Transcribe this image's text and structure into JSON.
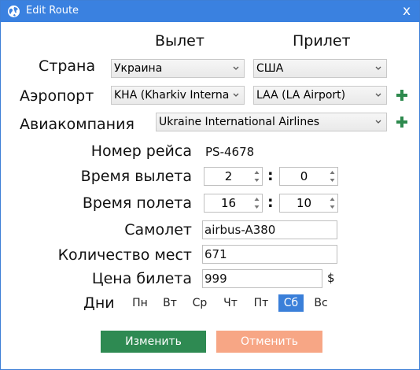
{
  "window": {
    "title": "Edit Route",
    "close_glyph": "x"
  },
  "columns": {
    "departure": "Вылет",
    "arrival": "Прилет"
  },
  "labels": {
    "country": "Страна",
    "airport": "Аэропорт",
    "airline": "Авиакомпания",
    "flight_number": "Номер рейса",
    "departure_time": "Время вылета",
    "flight_time": "Время полета",
    "aircraft": "Самолет",
    "seats": "Количество мест",
    "price": "Цена билета",
    "days": "Дни"
  },
  "fields": {
    "country_from": "Украина",
    "country_to": "США",
    "airport_from": "KHA (Kharkiv Interna",
    "airport_to": "LAA (LA Airport)",
    "airline": "Ukraine International Airlines",
    "flight_number": "PS-4678",
    "departure_hours": "2",
    "departure_minutes": "0",
    "flight_hours": "16",
    "flight_minutes": "10",
    "time_separator": ":",
    "aircraft": "airbus-A380",
    "seats": "671",
    "price": "999",
    "currency": "$"
  },
  "days": [
    {
      "label": "Пн",
      "selected": false
    },
    {
      "label": "Вт",
      "selected": false
    },
    {
      "label": "Ср",
      "selected": false
    },
    {
      "label": "Чт",
      "selected": false
    },
    {
      "label": "Пт",
      "selected": false
    },
    {
      "label": "Сб",
      "selected": true
    },
    {
      "label": "Вс",
      "selected": false
    }
  ],
  "buttons": {
    "save": "Изменить",
    "cancel": "Отменить"
  },
  "colors": {
    "titlebar": "#3a81e0",
    "accent_green": "#2e8a52",
    "cancel_orange": "#f7a685",
    "selected_day": "#3a7fd9"
  },
  "icons": {
    "app": "globe-icon",
    "add": "plus-icon",
    "dropdown": "chevron-down-icon",
    "spinner": "spinner-arrows-icon"
  }
}
